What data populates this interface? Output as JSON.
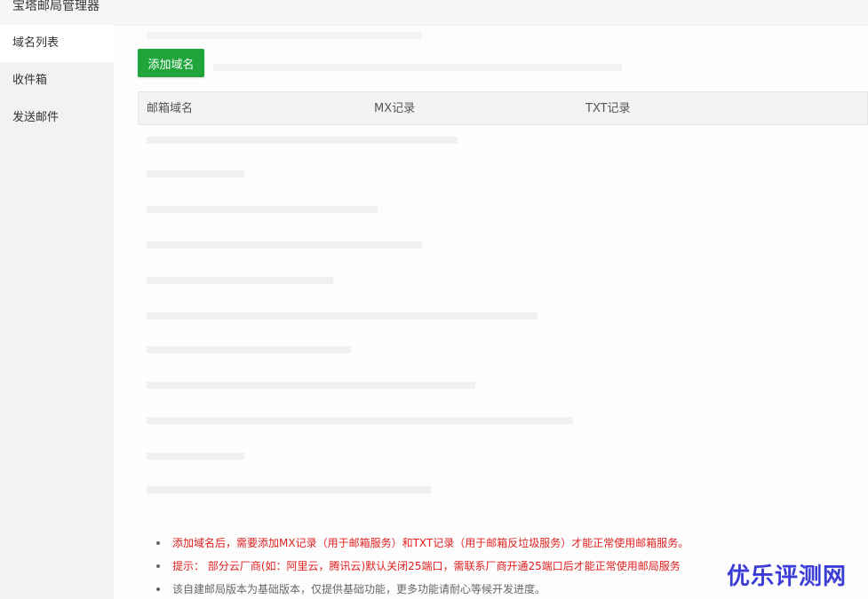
{
  "window": {
    "title": "宝塔邮局管理器"
  },
  "sidebar": {
    "items": [
      {
        "label": "域名列表",
        "active": true
      },
      {
        "label": "收件箱",
        "active": false
      },
      {
        "label": "发送邮件",
        "active": false
      }
    ]
  },
  "toolbar": {
    "add_domain_label": "添加域名"
  },
  "table": {
    "headers": [
      "邮箱域名",
      "MX记录",
      "TXT记录"
    ]
  },
  "tips": [
    {
      "text": "添加域名后，需要添加MX记录（用于邮箱服务）和TXT记录（用于邮箱反垃圾服务）才能正常使用邮箱服务。",
      "color": "#e02020"
    },
    {
      "text": "提示： 部分云厂商(如：阿里云，腾讯云)默认关闭25端口，需联系厂商开通25端口后才能正常使用邮局服务",
      "color": "#e02020"
    },
    {
      "text": "该自建邮局版本为基础版本，仅提供基础功能，更多功能请耐心等候开发进度。",
      "color": "#666666"
    }
  ],
  "watermark": {
    "text": "优乐评测网"
  },
  "colors": {
    "accent": "#20a53a",
    "warning": "#e02020"
  }
}
